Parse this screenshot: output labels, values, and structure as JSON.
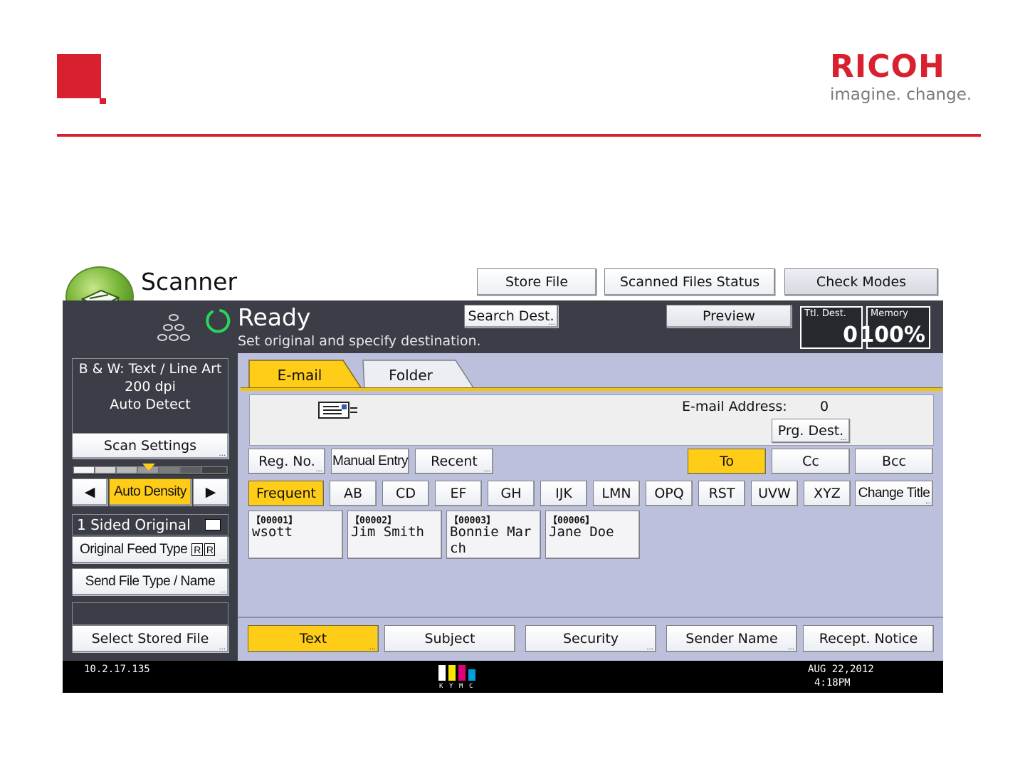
{
  "slide": {
    "brand": "RICOH",
    "tagline": "imagine. change.",
    "colors": {
      "brand_red": "#d8202f",
      "selected_yellow": "#ffcc18",
      "status_dark": "#3b3e46",
      "main_bg": "#bcc0dc"
    }
  },
  "app": {
    "title": "Scanner",
    "icon": "scanner-app-icon",
    "top_buttons": {
      "store_file": "Store File",
      "scanned_status": "Scanned Files Status",
      "check_modes": "Check Modes"
    }
  },
  "status": {
    "state": "Ready",
    "message": "Set original and specify destination.",
    "search_dest": "Search Dest.",
    "preview": "Preview",
    "ttl_dest_label": "Ttl. Dest.",
    "ttl_dest_value": "0",
    "memory_label": "Memory",
    "memory_value": "100%"
  },
  "left": {
    "scan_info": {
      "line1": "B & W: Text / Line Art",
      "line2": "200 dpi",
      "line3": "Auto Detect"
    },
    "scan_settings": "Scan Settings",
    "density": {
      "label": "Auto Density",
      "left_arrow": "◀",
      "right_arrow": "▶"
    },
    "original": "1 Sided Original",
    "original_feed": "Original Feed Type",
    "send_file": "Send File Type / Name",
    "select_stored": "Select Stored File"
  },
  "tabs": {
    "email": "E-mail",
    "folder": "Folder"
  },
  "destination": {
    "address_label": "E-mail Address:",
    "address_count": "0",
    "prg_dest": "Prg. Dest."
  },
  "entry_row": {
    "reg_no": "Reg. No.",
    "manual_entry": "Manual Entry",
    "recent": "Recent",
    "to": "To",
    "cc": "Cc",
    "bcc": "Bcc"
  },
  "index_tabs": [
    "Frequent",
    "AB",
    "CD",
    "EF",
    "GH",
    "IJK",
    "LMN",
    "OPQ",
    "RST",
    "UVW",
    "XYZ"
  ],
  "change_title": "Change Title",
  "entries": [
    {
      "no": "【00001】",
      "name": "wsott"
    },
    {
      "no": "【00002】",
      "name": "Jim Smith"
    },
    {
      "no": "【00003】",
      "name": "Bonnie March"
    },
    {
      "no": "【00006】",
      "name": "Jane Doe"
    }
  ],
  "bottom_buttons": {
    "text": "Text",
    "subject": "Subject",
    "security": "Security",
    "sender_name": "Sender Name",
    "recept_notice": "Recept. Notice"
  },
  "footer": {
    "ip": "10.2.17.135",
    "date": "AUG  22,2012",
    "time": "4:18PM",
    "toner_letters": [
      "K",
      "Y",
      "M",
      "C"
    ]
  }
}
